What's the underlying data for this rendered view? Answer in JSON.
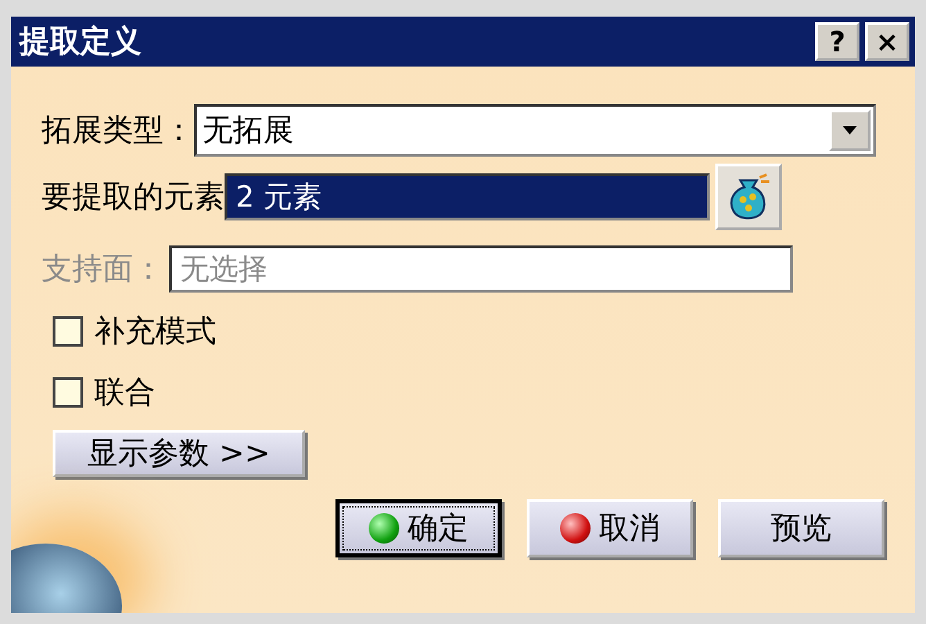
{
  "window": {
    "title": "提取定义",
    "help_button": "?",
    "close_button": "×"
  },
  "fields": [
    {
      "kind": "combo",
      "label": "拓展类型：",
      "value": "无拓展",
      "focused": false,
      "disabled": false
    },
    {
      "kind": "selection",
      "label": "要提取的元素",
      "value": "2 元素",
      "focused": true,
      "disabled": false
    },
    {
      "kind": "plain",
      "label": "支持面：",
      "value": "无选择",
      "focused": false,
      "disabled": true
    }
  ],
  "checkboxes": [
    {
      "label": "补充模式",
      "checked": false
    },
    {
      "label": "联合",
      "checked": false
    }
  ],
  "more_button": "显示参数 >>",
  "buttons": [
    {
      "kind": "ok",
      "label": "确定",
      "default": true
    },
    {
      "kind": "cancel",
      "label": "取消",
      "default": false
    },
    {
      "kind": "plain",
      "label": "预览",
      "default": false
    }
  ]
}
